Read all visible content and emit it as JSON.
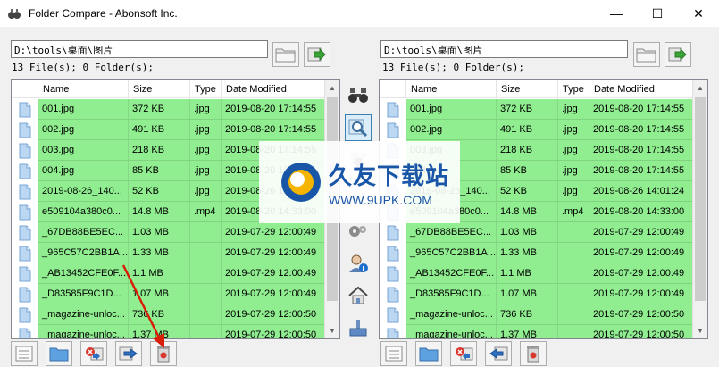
{
  "window": {
    "title": "Folder Compare - Abonsoft Inc.",
    "minimize_glyph": "—",
    "maximize_glyph": "☐",
    "close_glyph": "✕"
  },
  "left": {
    "path": "D:\\tools\\桌面\\图片",
    "count": "13 File(s); 0 Folder(s);",
    "columns": [
      "Name",
      "Size",
      "Type",
      "Date Modified"
    ],
    "rows": [
      [
        "001.jpg",
        "372 KB",
        ".jpg",
        "2019-08-20 17:14:55"
      ],
      [
        "002.jpg",
        "491 KB",
        ".jpg",
        "2019-08-20 17:14:55"
      ],
      [
        "003.jpg",
        "218 KB",
        ".jpg",
        "2019-08-20 17:14:55"
      ],
      [
        "004.jpg",
        "85 KB",
        ".jpg",
        "2019-08-20 17:14:55"
      ],
      [
        "2019-08-26_140...",
        "52 KB",
        ".jpg",
        "2019-08-26 14:01:24"
      ],
      [
        "e509104a380c0...",
        "14.8 MB",
        ".mp4",
        "2019-08-20 14:33:00"
      ],
      [
        "_67DB88BE5EC...",
        "1.03 MB",
        "",
        "2019-07-29 12:00:49"
      ],
      [
        "_965C57C2BB1A...",
        "1.33 MB",
        "",
        "2019-07-29 12:00:49"
      ],
      [
        "_AB13452CFE0F...",
        "1.1 MB",
        "",
        "2019-07-29 12:00:49"
      ],
      [
        "_D83585F9C1D...",
        "1.07 MB",
        "",
        "2019-07-29 12:00:49"
      ],
      [
        "_magazine-unloc...",
        "736 KB",
        "",
        "2019-07-29 12:00:50"
      ],
      [
        "_magazine-unloc...",
        "1.37 MB",
        "",
        "2019-07-29 12:00:50"
      ]
    ]
  },
  "right": {
    "path": "D:\\tools\\桌面\\图片",
    "count": "13 File(s); 0 Folder(s);",
    "columns": [
      "Name",
      "Size",
      "Type",
      "Date Modified"
    ],
    "rows": [
      [
        "001.jpg",
        "372 KB",
        ".jpg",
        "2019-08-20 17:14:55"
      ],
      [
        "002.jpg",
        "491 KB",
        ".jpg",
        "2019-08-20 17:14:55"
      ],
      [
        "003.jpg",
        "218 KB",
        ".jpg",
        "2019-08-20 17:14:55"
      ],
      [
        "004.jpg",
        "85 KB",
        ".jpg",
        "2019-08-20 17:14:55"
      ],
      [
        "2019-08-26_140...",
        "52 KB",
        ".jpg",
        "2019-08-26 14:01:24"
      ],
      [
        "e509104a380c0...",
        "14.8 MB",
        ".mp4",
        "2019-08-20 14:33:00"
      ],
      [
        "_67DB88BE5EC...",
        "1.03 MB",
        "",
        "2019-07-29 12:00:49"
      ],
      [
        "_965C57C2BB1A...",
        "1.33 MB",
        "",
        "2019-07-29 12:00:49"
      ],
      [
        "_AB13452CFE0F...",
        "1.1 MB",
        "",
        "2019-07-29 12:00:49"
      ],
      [
        "_D83585F9C1D...",
        "1.07 MB",
        "",
        "2019-07-29 12:00:49"
      ],
      [
        "_magazine-unloc...",
        "736 KB",
        "",
        "2019-07-29 12:00:50"
      ],
      [
        "_magazine-unloc...",
        "1.37 MB",
        "",
        "2019-07-29 12:00:50"
      ]
    ]
  },
  "watermark": {
    "main": "久友下载站",
    "sub": "WWW.9UPK.COM"
  },
  "colors": {
    "row_green": "#90ee90",
    "accent_blue": "#1a56a8",
    "arrow_red": "#d81e06"
  }
}
